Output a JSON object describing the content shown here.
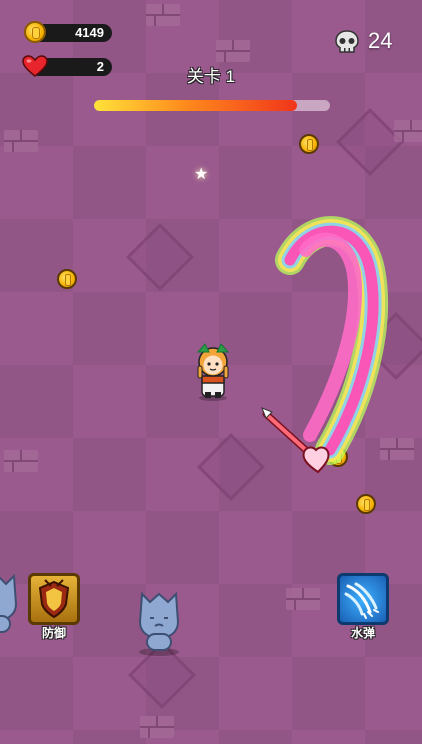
{
  "hud": {
    "coins": "4149",
    "lives": "2",
    "kills": "24",
    "icons": {
      "coin": "coin-icon",
      "heart": "heart-icon",
      "skull": "skull-icon"
    }
  },
  "level": {
    "title": "关卡 1",
    "progress": 0.86
  },
  "skills": {
    "defense_label": "防御",
    "water_label": "水弹"
  },
  "colors": {
    "background": "#9a5a8e",
    "progress_start": "#ffe23a",
    "progress_end": "#f0351b",
    "water_skill": "#1a78d6",
    "defense_skill": "#c88c1a"
  }
}
